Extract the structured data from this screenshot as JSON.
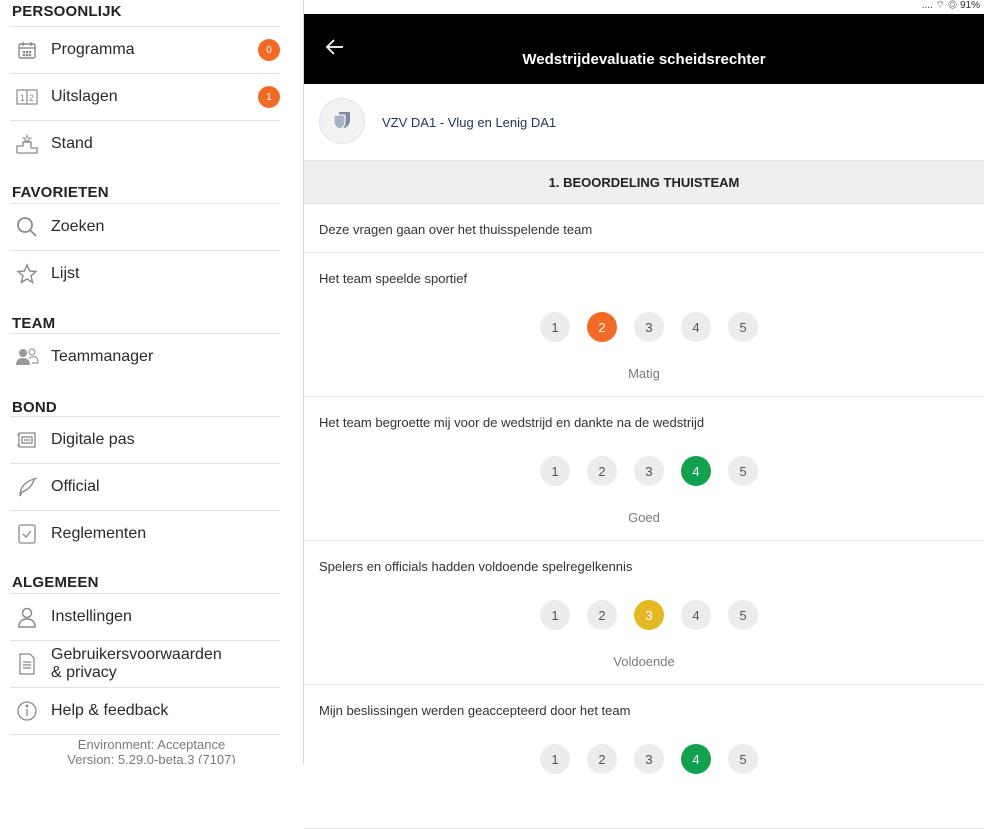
{
  "sidebar": {
    "sections": [
      {
        "title": "PERSOONLIJK"
      },
      {
        "title": "FAVORIETEN"
      },
      {
        "title": "TEAM"
      },
      {
        "title": "BOND"
      },
      {
        "title": "ALGEMEEN"
      }
    ],
    "items": [
      {
        "label": "Programma",
        "icon": "calendar-icon",
        "badge": "0"
      },
      {
        "label": "Uitslagen",
        "icon": "scoreboard-icon",
        "badge": "1"
      },
      {
        "label": "Stand",
        "icon": "podium-icon"
      },
      {
        "label": "Zoeken",
        "icon": "search-icon"
      },
      {
        "label": "Lijst",
        "icon": "star-icon"
      },
      {
        "label": "Teammanager",
        "icon": "users-icon"
      },
      {
        "label": "Digitale pas",
        "icon": "card-icon"
      },
      {
        "label": "Official",
        "icon": "whistle-icon"
      },
      {
        "label": "Reglementen",
        "icon": "checklist-icon"
      },
      {
        "label": "Instellingen",
        "icon": "person-icon"
      },
      {
        "label": "Gebruikersvoorwaarden\n& privacy",
        "icon": "document-icon"
      },
      {
        "label": "Help & feedback",
        "icon": "info-icon"
      }
    ],
    "environment": "Environment: Acceptance",
    "version": "Version: 5.29.0-beta.3 (7107)"
  },
  "status": {
    "text": "....  ⌔  ◎ 91%"
  },
  "appbar": {
    "title": "Wedstrijdevaluatie scheidsrechter",
    "back_icon": "arrow-left-icon"
  },
  "match": {
    "name": "VZV DA1 - Vlug en Lenig DA1"
  },
  "section": {
    "title": "1. BEOORDELING THUISTEAM",
    "intro": "Deze vragen gaan over het thuisspelende team"
  },
  "questions": [
    {
      "text": "Het team speelde sportief",
      "options": [
        "1",
        "2",
        "3",
        "4",
        "5"
      ],
      "selected": 2,
      "selected_label": "Matig",
      "color": "#f26b24"
    },
    {
      "text": "Het team begroette mij voor de wedstrijd en dankte na de wedstrijd",
      "options": [
        "1",
        "2",
        "3",
        "4",
        "5"
      ],
      "selected": 4,
      "selected_label": "Goed",
      "color": "#12a150"
    },
    {
      "text": "Spelers en officials hadden voldoende spelregelkennis",
      "options": [
        "1",
        "2",
        "3",
        "4",
        "5"
      ],
      "selected": 3,
      "selected_label": "Voldoende",
      "color": "#e6b824"
    },
    {
      "text": "Mijn beslissingen werden geaccepteerd door het team",
      "options": [
        "1",
        "2",
        "3",
        "4",
        "5"
      ],
      "selected": 4,
      "selected_label": "",
      "color": "#12a150"
    }
  ],
  "colors": {
    "accent": "#f26b24",
    "appbar": "#000000"
  }
}
